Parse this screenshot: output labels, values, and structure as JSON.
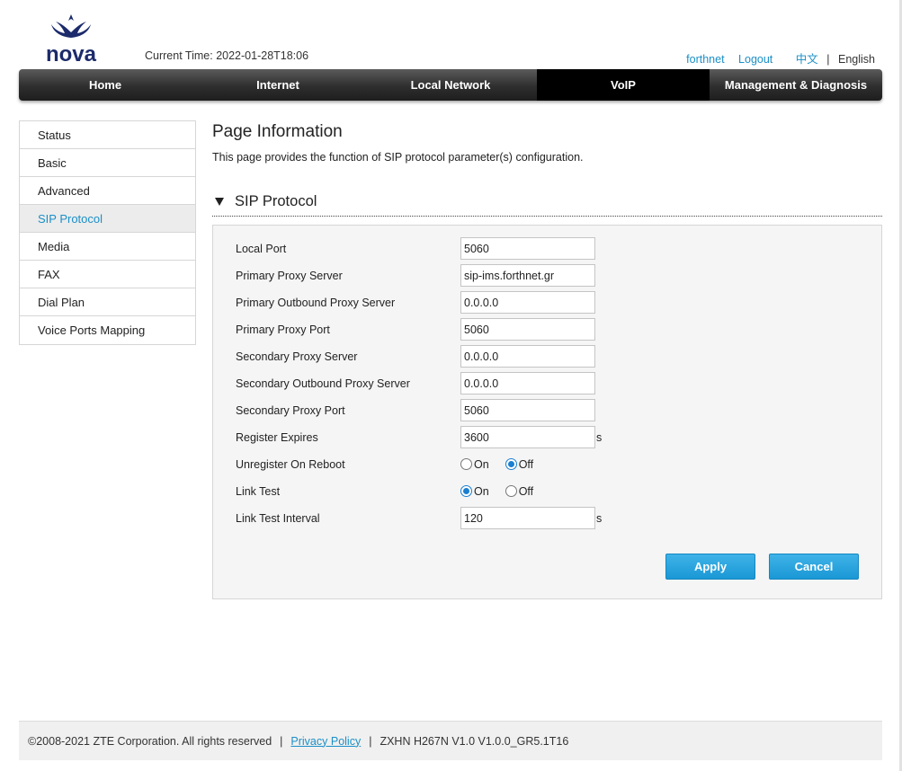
{
  "brand": {
    "logo_text": "nova",
    "logo_color": "#1c2b6b"
  },
  "header": {
    "current_time_label": "Current Time:",
    "current_time_value": "2022-01-28T18:06",
    "user": "forthnet",
    "logout": "Logout",
    "lang_zh": "中文",
    "lang_sep": "|",
    "lang_en": "English"
  },
  "nav": {
    "items": [
      "Home",
      "Internet",
      "Local Network",
      "VoIP",
      "Management & Diagnosis"
    ],
    "active": "VoIP"
  },
  "sidebar": {
    "items": [
      "Status",
      "Basic",
      "Advanced",
      "SIP Protocol",
      "Media",
      "FAX",
      "Dial Plan",
      "Voice Ports Mapping"
    ],
    "active": "SIP Protocol"
  },
  "page": {
    "title": "Page Information",
    "description": "This page provides the function of SIP protocol parameter(s) configuration.",
    "section_title": "SIP Protocol"
  },
  "form": {
    "local_port": {
      "label": "Local Port",
      "value": "5060"
    },
    "primary_proxy_server": {
      "label": "Primary Proxy Server",
      "value": "sip-ims.forthnet.gr"
    },
    "primary_outbound_proxy_server": {
      "label": "Primary Outbound Proxy Server",
      "value": "0.0.0.0"
    },
    "primary_proxy_port": {
      "label": "Primary Proxy Port",
      "value": "5060"
    },
    "secondary_proxy_server": {
      "label": "Secondary Proxy Server",
      "value": "0.0.0.0"
    },
    "secondary_outbound_proxy_server": {
      "label": "Secondary Outbound Proxy Server",
      "value": "0.0.0.0"
    },
    "secondary_proxy_port": {
      "label": "Secondary Proxy Port",
      "value": "5060"
    },
    "register_expires": {
      "label": "Register Expires",
      "value": "3600",
      "unit": "s"
    },
    "unregister_on_reboot": {
      "label": "Unregister On Reboot",
      "on": "On",
      "off": "Off",
      "selected": "Off"
    },
    "link_test": {
      "label": "Link Test",
      "on": "On",
      "off": "Off",
      "selected": "On"
    },
    "link_test_interval": {
      "label": "Link Test Interval",
      "value": "120",
      "unit": "s"
    },
    "apply": "Apply",
    "cancel": "Cancel"
  },
  "footer": {
    "copyright": "©2008-2021 ZTE Corporation. All rights reserved",
    "sep": "|",
    "privacy": "Privacy Policy",
    "model": "ZXHN H267N V1.0 V1.0.0_GR5.1T16"
  },
  "colors": {
    "accent": "#1b8fc7",
    "button": "#1a98d5",
    "nav_dark": "#2e2e2e"
  }
}
